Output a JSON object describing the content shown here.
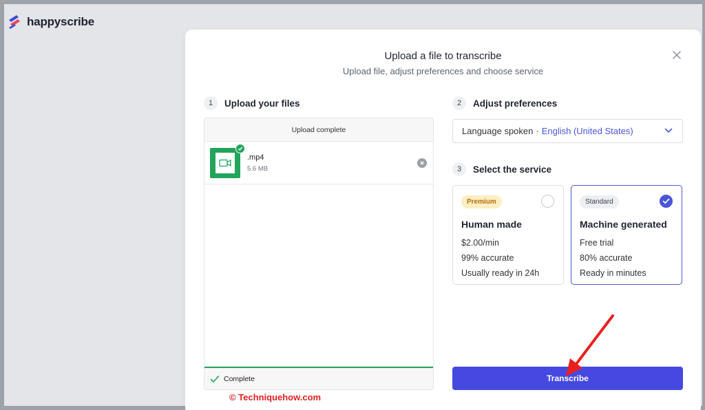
{
  "app": {
    "logo_text": "happyscribe",
    "brand_color": "#4549e0"
  },
  "modal": {
    "title": "Upload a file to transcribe",
    "subtitle": "Upload file, adjust preferences and choose service"
  },
  "steps": [
    {
      "num": "1",
      "label": "Upload your files"
    },
    {
      "num": "2",
      "label": "Adjust preferences"
    },
    {
      "num": "3",
      "label": "Select the service"
    }
  ],
  "upload": {
    "header": "Upload complete",
    "file": {
      "name": ".mp4",
      "size": "5.6 MB",
      "icon": "video-icon"
    },
    "footer_status": "Complete"
  },
  "preferences": {
    "language_label": "Language spoken",
    "separator": "·",
    "language_value": "English (United States)"
  },
  "services": [
    {
      "badge": "Premium",
      "title": "Human made",
      "lines": [
        "$2.00/min",
        "99% accurate",
        "Usually ready in 24h"
      ],
      "selected": false
    },
    {
      "badge": "Standard",
      "title": "Machine generated",
      "lines": [
        "Free trial",
        "80% accurate",
        "Ready in minutes"
      ],
      "selected": true
    }
  ],
  "actions": {
    "transcribe_label": "Transcribe"
  },
  "watermark": "© Techniquehow.com"
}
